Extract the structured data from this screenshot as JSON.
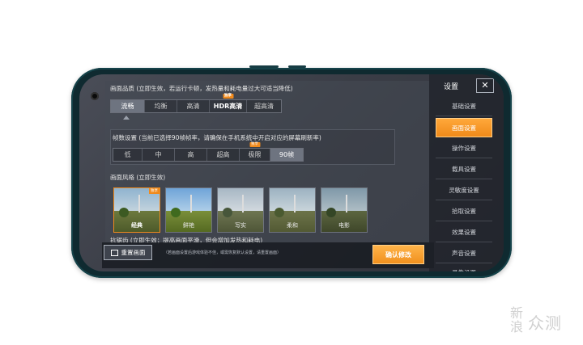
{
  "quality": {
    "title": "画面品质 (立即生效，若运行卡顿，发热量和耗电量过大可适当降低)",
    "options": [
      "流畅",
      "均衡",
      "高清",
      "HDR高清",
      "超高清"
    ],
    "selected_index": 0,
    "hdr_badge": "独享"
  },
  "fps": {
    "title": "帧数设置 (当前已选择90帧帧率，请确保在手机系统中开启对应的屏幕刷新率)",
    "options": [
      "低",
      "中",
      "高",
      "超高",
      "极限",
      "90帧"
    ],
    "selected_index": 5,
    "badge": "独享"
  },
  "style": {
    "title": "画面风格 (立即生效)",
    "cards": [
      {
        "label": "经典",
        "badge": "独享",
        "selected": true
      },
      {
        "label": "鲜艳",
        "selected": false
      },
      {
        "label": "写实",
        "selected": false
      },
      {
        "label": "柔和",
        "selected": false
      },
      {
        "label": "电影",
        "selected": false
      }
    ]
  },
  "antialias": {
    "title": "抗锯齿 (立即生效；提高画面平滑，但会增加发热和耗电)"
  },
  "bottom": {
    "reset_label": "重置画面",
    "hint": "（若画面设置后游戏体验不佳，或需恢复默认设置，请重置画面）",
    "confirm_label": "确认修改"
  },
  "sidebar": {
    "title": "设置",
    "close": "✕",
    "items": [
      "基础设置",
      "画面设置",
      "操作设置",
      "载具设置",
      "灵敏度设置",
      "拾取设置",
      "效果设置",
      "声音设置",
      "录像设置"
    ],
    "active_index": 1
  },
  "watermark": {
    "a": "新",
    "b": "浪",
    "c": "众测"
  },
  "colors": {
    "accent": "#f08a1c",
    "phone_frame": "#0f2a30"
  }
}
